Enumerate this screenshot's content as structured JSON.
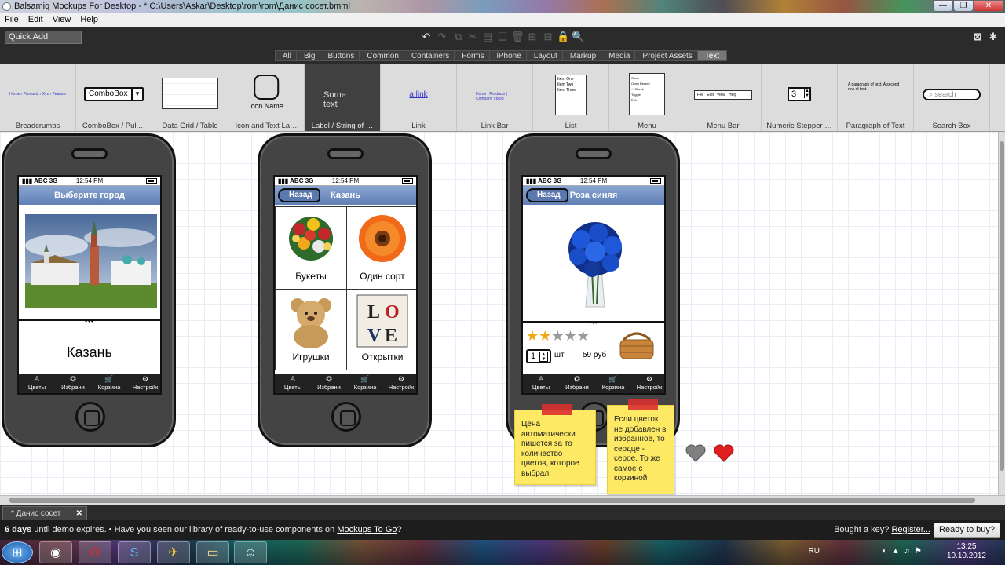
{
  "window": {
    "title": "Balsamiq Mockups For Desktop - * C:\\Users\\Askar\\Desktop\\rom\\rom\\Данис сосет.bmml",
    "minimize": "—",
    "restore": "❐",
    "close": "✕"
  },
  "menu": [
    "File",
    "Edit",
    "View",
    "Help"
  ],
  "toolbar": {
    "quick_add": "Quick Add",
    "icons": [
      "undo-icon",
      "redo-icon",
      "copy-icon",
      "cut-icon",
      "paste-icon",
      "duplicate-icon",
      "delete-icon",
      "group-icon",
      "ungroup-icon",
      "lock-icon",
      "search-icon"
    ]
  },
  "categories": [
    {
      "label": "All",
      "selected": false
    },
    {
      "label": "Big",
      "selected": false
    },
    {
      "label": "Buttons",
      "selected": false
    },
    {
      "label": "Common",
      "selected": false
    },
    {
      "label": "Containers",
      "selected": false
    },
    {
      "label": "Forms",
      "selected": false
    },
    {
      "label": "iPhone",
      "selected": false
    },
    {
      "label": "Layout",
      "selected": false
    },
    {
      "label": "Markup",
      "selected": false
    },
    {
      "label": "Media",
      "selected": false
    },
    {
      "label": "Project Assets",
      "selected": false
    },
    {
      "label": "Text",
      "selected": true
    }
  ],
  "library": {
    "items": [
      "Breadcrumbs",
      "ComboBox / Pull…",
      "Data Grid / Table",
      "Icon and Text La…",
      "Label / String of …",
      "Link",
      "Link Bar",
      "List",
      "Menu",
      "Menu Bar",
      "Numeric Stepper …",
      "Paragraph of Text",
      "Search Box"
    ],
    "combobox_text": "ComboBox",
    "icon_name_text": "Icon Name",
    "label_text": "Some text",
    "link_text": "a link",
    "stepper_value": "3",
    "search_placeholder": "search",
    "list_items": [
      "Item One",
      "Item Two",
      "Item Three"
    ],
    "menubar_items": [
      "File",
      "Edit",
      "View",
      "Help"
    ],
    "breadcrumb_text": "Home › Products › Xyz › Feature"
  },
  "phone1": {
    "signal": "▮▮▮ ABC 3G",
    "time": "12:54 PM",
    "title": "Выберите город",
    "city": "Казань"
  },
  "phone2": {
    "signal": "▮▮▮ ABC 3G",
    "time": "12:54 PM",
    "back": "Назад",
    "title": "Казань",
    "cells": [
      "Букеты",
      "Один сорт",
      "Игрушки",
      "Открытки"
    ]
  },
  "phone3": {
    "signal": "▮▮▮ ABC 3G",
    "time": "12:54 PM",
    "back": "Назад",
    "title": "Роза синяя",
    "qty": "1",
    "unit": "шт",
    "price": "59 руб",
    "rating": 2,
    "rating_max": 5
  },
  "tabs": [
    "Цветы",
    "Избрани",
    "Корзина",
    "Настройк"
  ],
  "tab_icons": [
    "flower-icon",
    "star-icon",
    "cart-icon",
    "settings-icon"
  ],
  "notes": {
    "note1": "Цена автоматически пишется за то количество цветов, которое выбрал",
    "note2": "Если цветок не добавлен в избранное, то сердце - серое. То же самое с корзиной"
  },
  "doc_tab": {
    "label": "* Данис сосет",
    "close": "✕"
  },
  "notice": {
    "days": "6 days",
    "text1": " until demo expires.  •  Have you seen our library of ready-to-use components on ",
    "link": "Mockups To Go",
    "text2": "?",
    "bought": "Bought a key? ",
    "register": "Register...",
    "buy": "Ready to buy?"
  },
  "tray": {
    "lang": "RU",
    "time": "13:25",
    "date": "10.10.2012"
  },
  "colors": {
    "accent": "#5f7fb6",
    "note": "#fde964",
    "heart_red": "#e02020",
    "heart_gray": "#808080"
  }
}
